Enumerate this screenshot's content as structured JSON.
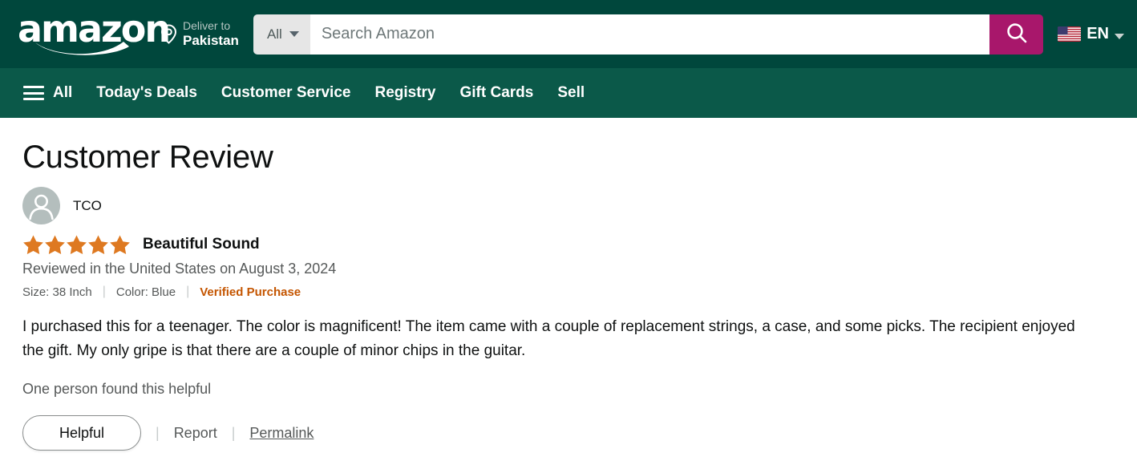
{
  "header": {
    "logo_text": "amazon",
    "deliver": {
      "label": "Deliver to",
      "location": "Pakistan",
      "icon": "location-pin-icon"
    },
    "search": {
      "category": "All",
      "placeholder": "Search Amazon",
      "value": "",
      "button_icon": "search-icon",
      "button_color": "#a8176b"
    },
    "language": {
      "code": "EN",
      "flag": "us-flag-icon"
    },
    "bar_color": "#00473c"
  },
  "nav": {
    "bar_color": "#0b5949",
    "all_label": "All",
    "items": [
      {
        "label": "Today's Deals"
      },
      {
        "label": "Customer Service"
      },
      {
        "label": "Registry"
      },
      {
        "label": "Gift Cards"
      },
      {
        "label": "Sell"
      }
    ]
  },
  "main": {
    "page_title": "Customer Review",
    "reviewer": {
      "name": "TCO",
      "avatar_icon": "user-avatar-icon"
    },
    "rating": {
      "stars": 5,
      "max_stars": 5,
      "star_color": "#de7921"
    },
    "review_title": "Beautiful Sound",
    "review_date": "Reviewed in the United States on August 3, 2024",
    "attributes": {
      "size": "Size: 38 Inch",
      "color": "Color: Blue",
      "verified": "Verified Purchase",
      "verified_color": "#c45500"
    },
    "review_body": "I purchased this for a teenager. The color is magnificent! The item came with a couple of replacement strings, a case, and some picks. The recipient enjoyed the gift. My only gripe is that there are a couple of minor chips in the guitar.",
    "helpful_count_text": "One person found this helpful",
    "actions": {
      "helpful_label": "Helpful",
      "report_label": "Report",
      "permalink_label": "Permalink"
    }
  }
}
